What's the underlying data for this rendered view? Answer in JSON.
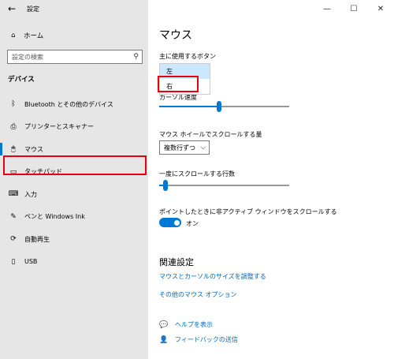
{
  "window": {
    "title": "設定",
    "back_icon": "back-arrow-icon"
  },
  "controls": {
    "minimize": "—",
    "maximize": "☐",
    "close": "✕"
  },
  "sidebar": {
    "home_label": "ホーム",
    "search_placeholder": "設定の検索",
    "section": "デバイス",
    "items": [
      {
        "label": "Bluetooth とその他のデバイス",
        "icon": "bluetooth-icon",
        "glyph": "ᛒ"
      },
      {
        "label": "プリンターとスキャナー",
        "icon": "printer-icon",
        "glyph": "⎙"
      },
      {
        "label": "マウス",
        "icon": "mouse-icon",
        "glyph": "🖱"
      },
      {
        "label": "タッチパッド",
        "icon": "touchpad-icon",
        "glyph": "▭"
      },
      {
        "label": "入力",
        "icon": "keyboard-icon",
        "glyph": "⌨"
      },
      {
        "label": "ペンと Windows Ink",
        "icon": "pen-icon",
        "glyph": "✎"
      },
      {
        "label": "自動再生",
        "icon": "autoplay-icon",
        "glyph": "⟳"
      },
      {
        "label": "USB",
        "icon": "usb-icon",
        "glyph": "▯"
      }
    ]
  },
  "main": {
    "title": "マウス",
    "primary_button_label": "主に使用するボタン",
    "primary_button_options": [
      "左",
      "右"
    ],
    "cursor_speed_label": "カーソル速度",
    "cursor_speed_value": 0.46,
    "wheel_label": "マウス ホイールでスクロールする量",
    "wheel_value": "複数行ずつ",
    "lines_label": "一度にスクロールする行数",
    "lines_value": 0.03,
    "inactive_label": "ポイントしたときに非アクティブ ウィンドウをスクロールする",
    "toggle_state": "オン",
    "related_heading": "関連設定",
    "link1": "マウスとカーソルのサイズを調整する",
    "link2": "その他のマウス オプション",
    "help_link": "ヘルプを表示",
    "feedback_link": "フィードバックの送信"
  },
  "colors": {
    "accent": "#0078d7",
    "highlight": "#e60012",
    "sidebar_bg": "#e6e6e6"
  }
}
